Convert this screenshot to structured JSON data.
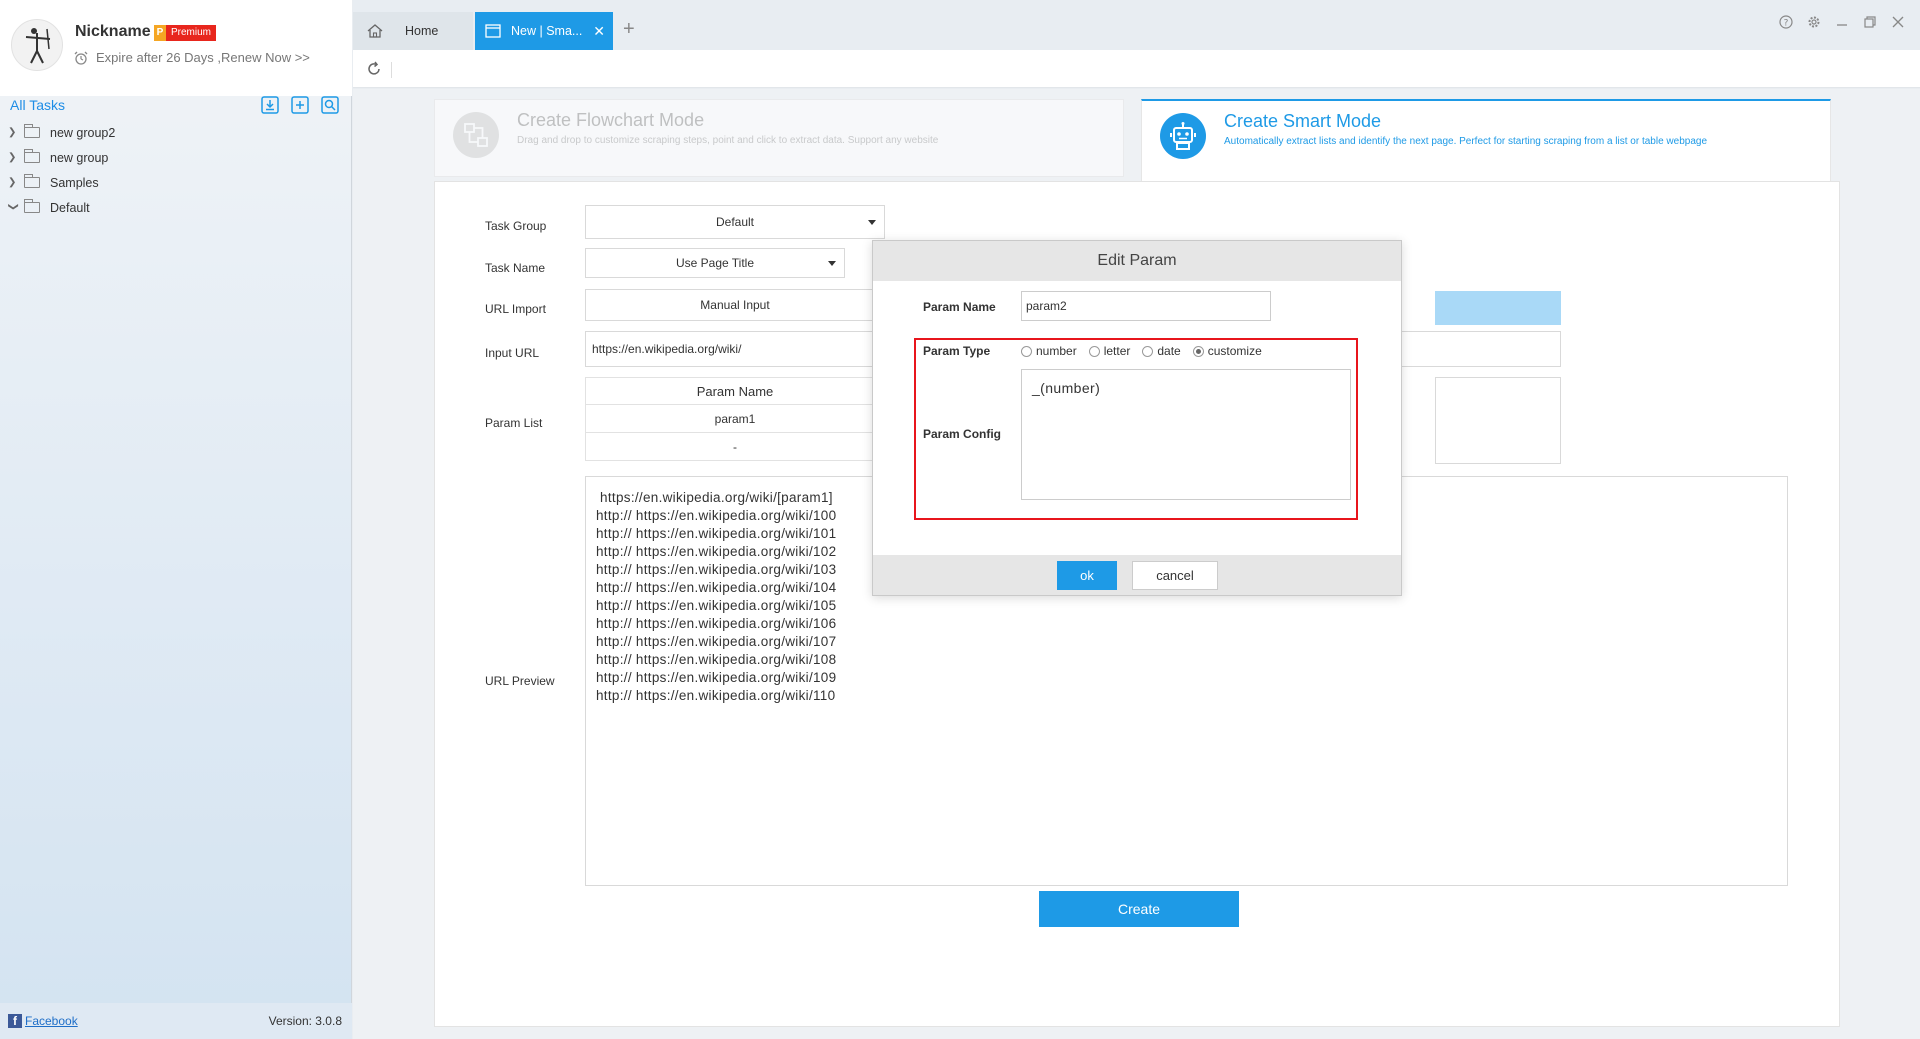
{
  "profile": {
    "nickname": "Nickname",
    "badge_p": "P",
    "badge_label": "Premium",
    "expire_text": "Expire after 26 Days ,Renew Now >>"
  },
  "sidebar": {
    "title": "All Tasks",
    "tools": [
      "import-icon",
      "add-task-icon",
      "search-task-icon"
    ],
    "items": [
      {
        "label": "new group2",
        "expanded": false
      },
      {
        "label": "new group",
        "expanded": false
      },
      {
        "label": "Samples",
        "expanded": false
      },
      {
        "label": "Default",
        "expanded": true
      }
    ],
    "footer": {
      "facebook": "Facebook",
      "version": "Version: 3.0.8"
    }
  },
  "tabs": {
    "home": "Home",
    "active": "New | Sma...",
    "add": "+"
  },
  "modes": {
    "flowchart": {
      "title": "Create Flowchart Mode",
      "desc": "Drag and drop to customize scraping steps, point and click to extract data. Support any website"
    },
    "smart": {
      "title": "Create Smart Mode",
      "desc": "Automatically extract lists and identify the next page. Perfect for starting scraping from a list or table webpage"
    }
  },
  "form": {
    "task_group_label": "Task Group",
    "task_group_value": "Default",
    "task_name_label": "Task Name",
    "task_name_value": "Use Page Title",
    "url_import_label": "URL Import",
    "url_import_value": "Manual Input",
    "input_url_label": "Input URL",
    "input_url_value": "https://en.wikipedia.org/wiki/",
    "param_list_label": "Param List",
    "param_table": {
      "header": "Param Name",
      "rows": [
        "param1",
        "-"
      ]
    },
    "url_preview_label": "URL Preview",
    "url_preview_lines": [
      " https://en.wikipedia.org/wiki/[param1]",
      "http:// https://en.wikipedia.org/wiki/100",
      "http:// https://en.wikipedia.org/wiki/101",
      "http:// https://en.wikipedia.org/wiki/102",
      "http:// https://en.wikipedia.org/wiki/103",
      "http:// https://en.wikipedia.org/wiki/104",
      "http:// https://en.wikipedia.org/wiki/105",
      "http:// https://en.wikipedia.org/wiki/106",
      "http:// https://en.wikipedia.org/wiki/107",
      "http:// https://en.wikipedia.org/wiki/108",
      "http:// https://en.wikipedia.org/wiki/109",
      "http:// https://en.wikipedia.org/wiki/110"
    ],
    "create_label": "Create"
  },
  "modal": {
    "title": "Edit Param",
    "param_name_label": "Param Name",
    "param_name_value": "param2",
    "param_type_label": "Param Type",
    "param_types": [
      {
        "label": "number",
        "checked": false
      },
      {
        "label": "letter",
        "checked": false
      },
      {
        "label": "date",
        "checked": false
      },
      {
        "label": "customize",
        "checked": true
      }
    ],
    "param_config_label": "Param Config",
    "param_config_value": "_(number)",
    "ok_label": "ok",
    "cancel_label": "cancel"
  },
  "colors": {
    "accent": "#1e9ae6",
    "highlight": "#e8151c",
    "badge_red": "#e8261d"
  }
}
